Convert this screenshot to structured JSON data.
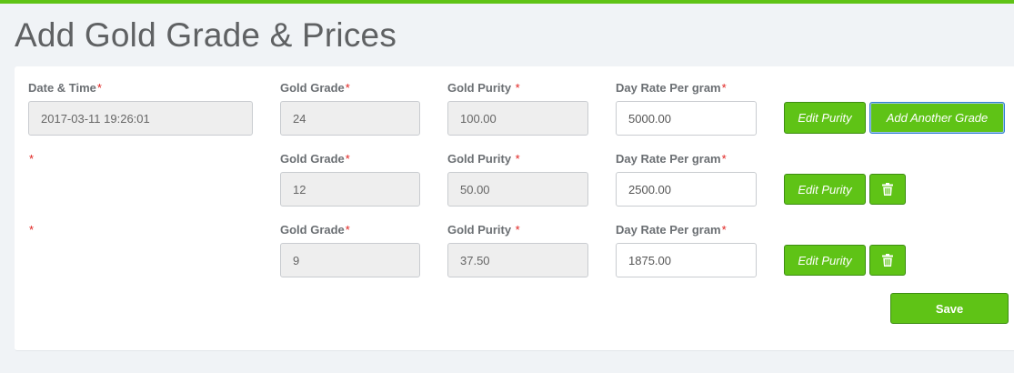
{
  "page": {
    "title": "Add Gold Grade & Prices"
  },
  "labels": {
    "date_time": "Date & Time",
    "gold_grade": "Gold Grade",
    "gold_purity": "Gold Purity ",
    "day_rate": "Day Rate Per gram",
    "required_mark": "*"
  },
  "form": {
    "date_time_value": "2017-03-11 19:26:01",
    "rows": [
      {
        "grade": "24",
        "purity": "100.00",
        "rate": "5000.00"
      },
      {
        "grade": "12",
        "purity": "50.00",
        "rate": "2500.00"
      },
      {
        "grade": "9",
        "purity": "37.50",
        "rate": "1875.00"
      }
    ]
  },
  "buttons": {
    "edit_purity": "Edit Purity",
    "add_another_grade": "Add Another Grade",
    "save": "Save"
  },
  "icons": {
    "delete": "trash-icon"
  },
  "colors": {
    "accent": "#5fc316",
    "required": "#e0221f"
  }
}
